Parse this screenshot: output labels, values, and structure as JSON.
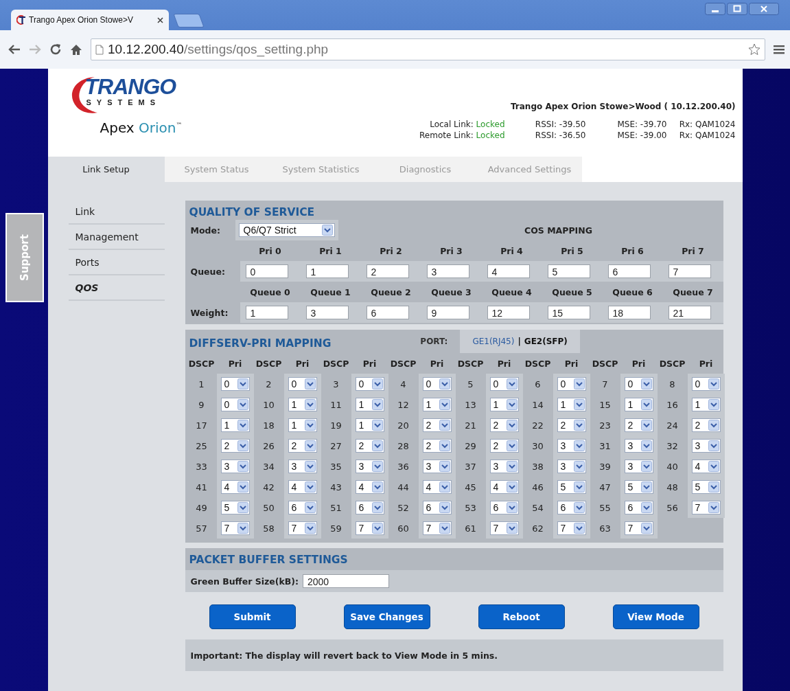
{
  "browser": {
    "tab_title": "Trango Apex Orion Stowe>V",
    "url_host": "10.12.200.40",
    "url_path": "/settings/qos_setting.php"
  },
  "header": {
    "logo": {
      "brand": "TRANGO",
      "sub": "SYSTEMS",
      "product_a": "Apex",
      "product_b": "Orion",
      "tm": "™"
    },
    "device_title": "Trango Apex Orion Stowe>Wood ( 10.12.200.40)",
    "links": [
      {
        "label": "Local Link:",
        "status": "Locked",
        "rssi": "RSSI: -39.50",
        "mse": "MSE: -39.70",
        "rx": "Rx: QAM1024"
      },
      {
        "label": "Remote Link:",
        "status": "Locked",
        "rssi": "RSSI: -36.50",
        "mse": "MSE: -39.00",
        "rx": "Rx: QAM1024"
      }
    ]
  },
  "nav_tabs": [
    {
      "label": "Link Setup",
      "selected": true
    },
    {
      "label": "System Status",
      "selected": false
    },
    {
      "label": "System Statistics",
      "selected": false
    },
    {
      "label": "Diagnostics",
      "selected": false
    },
    {
      "label": "Advanced Settings",
      "selected": false
    }
  ],
  "support_tab": "Support",
  "sidebar": [
    {
      "label": "Link",
      "selected": false
    },
    {
      "label": "Management",
      "selected": false
    },
    {
      "label": "Ports",
      "selected": false
    },
    {
      "label": "QOS",
      "selected": true
    }
  ],
  "qos": {
    "title": "QUALITY OF SERVICE",
    "mode_label": "Mode:",
    "mode_value": "Q6/Q7 Strict",
    "cos_title": "COS MAPPING",
    "pri_headers": [
      "Pri 0",
      "Pri 1",
      "Pri 2",
      "Pri 3",
      "Pri 4",
      "Pri 5",
      "Pri 6",
      "Pri 7"
    ],
    "queue_label": "Queue:",
    "queues": [
      "0",
      "1",
      "2",
      "3",
      "4",
      "5",
      "6",
      "7"
    ],
    "queue_headers": [
      "Queue 0",
      "Queue 1",
      "Queue 2",
      "Queue 3",
      "Queue 4",
      "Queue 5",
      "Queue 6",
      "Queue 7"
    ],
    "weight_label": "Weight:",
    "weights": [
      "1",
      "3",
      "6",
      "9",
      "12",
      "15",
      "18",
      "21"
    ]
  },
  "diffserv": {
    "title": "DIFFSERV-PRI MAPPING",
    "port_label": "PORT:",
    "ports": [
      {
        "label": "GE1(RJ45)",
        "selected": false
      },
      {
        "label": "GE2(SFP)",
        "selected": true
      }
    ],
    "separator": "|",
    "columns": [
      "DSCP",
      "Pri",
      "DSCP",
      "Pri",
      "DSCP",
      "Pri",
      "DSCP",
      "Pri",
      "DSCP",
      "Pri",
      "DSCP",
      "Pri",
      "DSCP",
      "Pri",
      "DSCP",
      "Pri"
    ],
    "mappings": [
      {
        "dscp": "1",
        "pri": "0"
      },
      {
        "dscp": "2",
        "pri": "0"
      },
      {
        "dscp": "3",
        "pri": "0"
      },
      {
        "dscp": "4",
        "pri": "0"
      },
      {
        "dscp": "5",
        "pri": "0"
      },
      {
        "dscp": "6",
        "pri": "0"
      },
      {
        "dscp": "7",
        "pri": "0"
      },
      {
        "dscp": "8",
        "pri": "0"
      },
      {
        "dscp": "9",
        "pri": "0"
      },
      {
        "dscp": "10",
        "pri": "1"
      },
      {
        "dscp": "11",
        "pri": "1"
      },
      {
        "dscp": "12",
        "pri": "1"
      },
      {
        "dscp": "13",
        "pri": "1"
      },
      {
        "dscp": "14",
        "pri": "1"
      },
      {
        "dscp": "15",
        "pri": "1"
      },
      {
        "dscp": "16",
        "pri": "1"
      },
      {
        "dscp": "17",
        "pri": "1"
      },
      {
        "dscp": "18",
        "pri": "1"
      },
      {
        "dscp": "19",
        "pri": "1"
      },
      {
        "dscp": "20",
        "pri": "2"
      },
      {
        "dscp": "21",
        "pri": "2"
      },
      {
        "dscp": "22",
        "pri": "2"
      },
      {
        "dscp": "23",
        "pri": "2"
      },
      {
        "dscp": "24",
        "pri": "2"
      },
      {
        "dscp": "25",
        "pri": "2"
      },
      {
        "dscp": "26",
        "pri": "2"
      },
      {
        "dscp": "27",
        "pri": "2"
      },
      {
        "dscp": "28",
        "pri": "2"
      },
      {
        "dscp": "29",
        "pri": "2"
      },
      {
        "dscp": "30",
        "pri": "3"
      },
      {
        "dscp": "31",
        "pri": "3"
      },
      {
        "dscp": "32",
        "pri": "3"
      },
      {
        "dscp": "33",
        "pri": "3"
      },
      {
        "dscp": "34",
        "pri": "3"
      },
      {
        "dscp": "35",
        "pri": "3"
      },
      {
        "dscp": "36",
        "pri": "3"
      },
      {
        "dscp": "37",
        "pri": "3"
      },
      {
        "dscp": "38",
        "pri": "3"
      },
      {
        "dscp": "39",
        "pri": "3"
      },
      {
        "dscp": "40",
        "pri": "4"
      },
      {
        "dscp": "41",
        "pri": "4"
      },
      {
        "dscp": "42",
        "pri": "4"
      },
      {
        "dscp": "43",
        "pri": "4"
      },
      {
        "dscp": "44",
        "pri": "4"
      },
      {
        "dscp": "45",
        "pri": "4"
      },
      {
        "dscp": "46",
        "pri": "5"
      },
      {
        "dscp": "47",
        "pri": "5"
      },
      {
        "dscp": "48",
        "pri": "5"
      },
      {
        "dscp": "49",
        "pri": "5"
      },
      {
        "dscp": "50",
        "pri": "6"
      },
      {
        "dscp": "51",
        "pri": "6"
      },
      {
        "dscp": "52",
        "pri": "6"
      },
      {
        "dscp": "53",
        "pri": "6"
      },
      {
        "dscp": "54",
        "pri": "6"
      },
      {
        "dscp": "55",
        "pri": "6"
      },
      {
        "dscp": "56",
        "pri": "7"
      },
      {
        "dscp": "57",
        "pri": "7"
      },
      {
        "dscp": "58",
        "pri": "7"
      },
      {
        "dscp": "59",
        "pri": "7"
      },
      {
        "dscp": "60",
        "pri": "7"
      },
      {
        "dscp": "61",
        "pri": "7"
      },
      {
        "dscp": "62",
        "pri": "7"
      },
      {
        "dscp": "63",
        "pri": "7"
      }
    ]
  },
  "buffer": {
    "title": "PACKET BUFFER SETTINGS",
    "label": "Green Buffer Size(kB):",
    "value": "2000"
  },
  "buttons": [
    "Submit",
    "Save Changes",
    "Reboot",
    "View Mode"
  ],
  "notice": "Important: The display will revert back to View Mode in 5 mins."
}
